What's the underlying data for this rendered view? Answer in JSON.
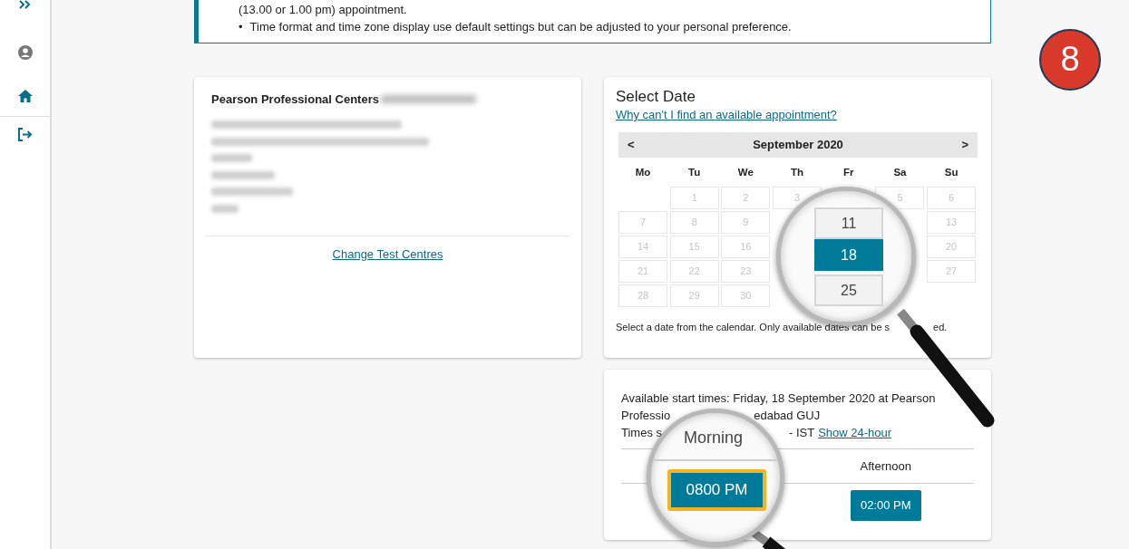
{
  "notice": {
    "continuation": "(13.00 or 1.00 pm) appointment.",
    "marker": "•",
    "bullets": [
      "Time format and time zone display use default settings but can be adjusted to your personal preference."
    ]
  },
  "step_badge": {
    "text": "8"
  },
  "test_centre": {
    "name": "Pearson Professional Centers",
    "link": "Change Test Centres"
  },
  "select_date": {
    "title": "Select Date",
    "help_link": "Why can't I find an available appointment?",
    "calendar": {
      "prev": "<",
      "month": "September 2020",
      "next": ">",
      "weekdays": [
        "Mo",
        "Tu",
        "We",
        "Th",
        "Fr",
        "Sa",
        "Su"
      ],
      "weeks": [
        [
          {
            "kind": "blank"
          },
          {
            "kind": "day",
            "day": "1",
            "available": false
          },
          {
            "kind": "day",
            "day": "2",
            "available": false
          },
          {
            "kind": "day",
            "day": "3",
            "available": false
          },
          {
            "kind": "blank"
          },
          {
            "kind": "day",
            "day": "5",
            "available": false
          },
          {
            "kind": "day",
            "day": "6",
            "available": false
          }
        ],
        [
          {
            "kind": "day",
            "day": "7",
            "available": false
          },
          {
            "kind": "day",
            "day": "8",
            "available": false
          },
          {
            "kind": "day",
            "day": "9",
            "available": false
          },
          {
            "kind": "blank"
          },
          {
            "kind": "blank"
          },
          {
            "kind": "blank"
          },
          {
            "kind": "day",
            "day": "13",
            "available": false
          }
        ],
        [
          {
            "kind": "day",
            "day": "14",
            "available": false
          },
          {
            "kind": "day",
            "day": "15",
            "available": false
          },
          {
            "kind": "day",
            "day": "16",
            "available": false
          },
          {
            "kind": "blank"
          },
          {
            "kind": "blank"
          },
          {
            "kind": "blank"
          },
          {
            "kind": "day",
            "day": "20",
            "available": false
          }
        ],
        [
          {
            "kind": "day",
            "day": "21",
            "available": false
          },
          {
            "kind": "day",
            "day": "22",
            "available": false
          },
          {
            "kind": "day",
            "day": "23",
            "available": false
          },
          {
            "kind": "blank"
          },
          {
            "kind": "blank"
          },
          {
            "kind": "blank"
          },
          {
            "kind": "day",
            "day": "27",
            "available": false
          }
        ],
        [
          {
            "kind": "day",
            "day": "28",
            "available": false
          },
          {
            "kind": "day",
            "day": "29",
            "available": false
          },
          {
            "kind": "day",
            "day": "30",
            "available": false
          }
        ]
      ]
    },
    "hint": [
      "Select a date from the calendar. Only available dates can be s",
      "ed."
    ],
    "magnifier": {
      "days": [
        {
          "day": "11",
          "selected": false
        },
        {
          "day": "18",
          "selected": true
        },
        {
          "day": "25",
          "selected": false
        }
      ]
    }
  },
  "start_times": {
    "lines": [
      [
        "Available start times: Friday, 18 September 2020 at Pearson"
      ],
      [
        "Professio",
        "edabad GUJ"
      ],
      [
        "Times s",
        "- IST"
      ]
    ],
    "show_24_link": "Show 24-hour",
    "columns": [
      "Afternoon"
    ],
    "slots": [
      {
        "label": "02:00 PM",
        "focused": false
      }
    ],
    "magnifier": {
      "heading": "Morning",
      "slot": {
        "label": "0800 PM",
        "focused": true
      }
    }
  }
}
